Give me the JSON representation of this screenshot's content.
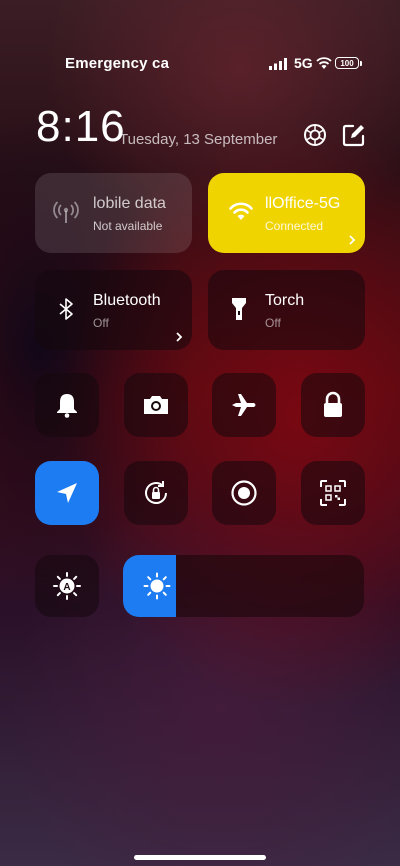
{
  "status_bar": {
    "carrier": "Emergency ca",
    "network": "5G",
    "battery": "100"
  },
  "header": {
    "time": "8:16",
    "date": "Tuesday, 13 September",
    "settings_icon": "settings-icon",
    "edit_icon": "edit-icon"
  },
  "big_tiles": [
    {
      "label": "lobile data",
      "sub": "Not available",
      "icon": "antenna-icon",
      "state": "unavailable"
    },
    {
      "label": "llOffice-5G",
      "sub": "Connected",
      "icon": "wifi-icon",
      "state": "on",
      "color": "#f0d400"
    },
    {
      "label": "Bluetooth",
      "sub": "Off",
      "icon": "bluetooth-icon",
      "state": "off"
    },
    {
      "label": "Torch",
      "sub": "Off",
      "icon": "torch-icon",
      "state": "off"
    }
  ],
  "small_toggles": [
    {
      "name": "bell-icon",
      "state": "off"
    },
    {
      "name": "camera-icon",
      "state": "off"
    },
    {
      "name": "airplane-icon",
      "state": "off"
    },
    {
      "name": "lock-icon",
      "state": "off"
    },
    {
      "name": "location-icon",
      "state": "on",
      "color": "#1e7cf2"
    },
    {
      "name": "rotation-lock-icon",
      "state": "off"
    },
    {
      "name": "screen-record-icon",
      "state": "off"
    },
    {
      "name": "qr-scan-icon",
      "state": "off"
    }
  ],
  "brightness": {
    "auto_icon": "auto-brightness-icon",
    "level": 0.22
  }
}
